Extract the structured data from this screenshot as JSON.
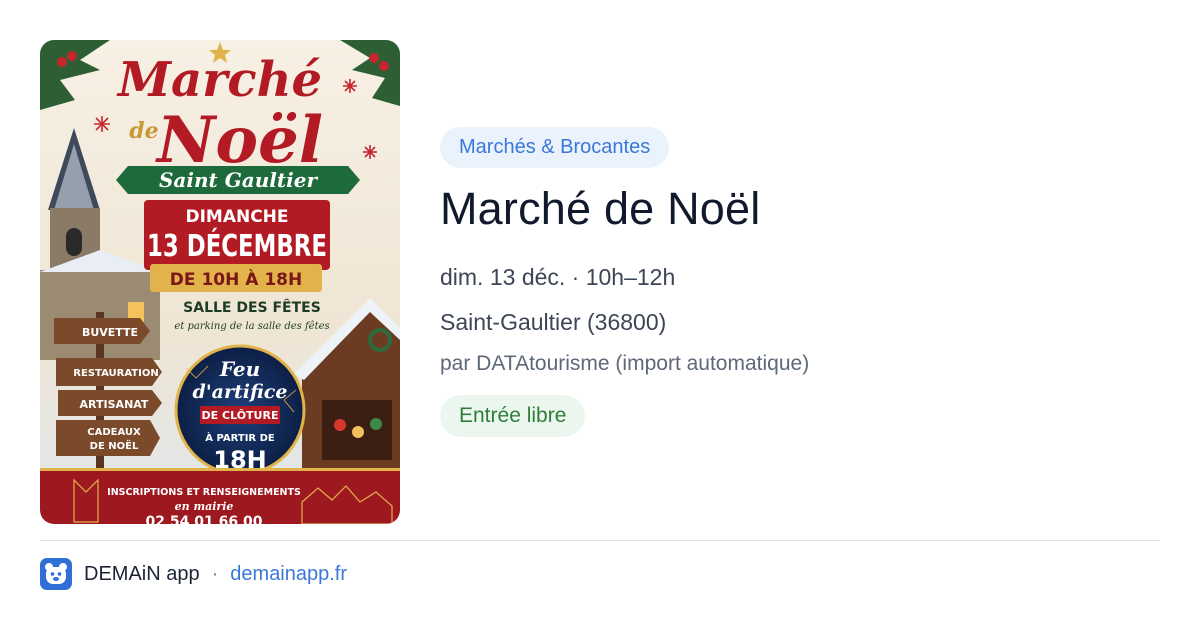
{
  "card": {
    "category": "Marchés & Brocantes",
    "title": "Marché de Noël",
    "date_time": "dim. 13 déc. · 10h–12h",
    "location": "Saint-Gaultier (36800)",
    "source": "par DATAtourisme (import automatique)",
    "price_badge": "Entrée libre"
  },
  "poster": {
    "title_line1": "Marché",
    "title_de": "de",
    "title_line2": "Noël",
    "town": "Saint Gaultier",
    "day": "DIMANCHE",
    "date": "13 DÉCEMBRE",
    "hours": "DE 10H À 18H",
    "venue": "SALLE DES FÊTES",
    "parking": "et parking de la salle des fêtes",
    "signs": [
      "BUVETTE",
      "RESTAURATION",
      "ARTISANAT",
      "CADEAUX",
      "DE NOËL"
    ],
    "fireworks_1": "Feu",
    "fireworks_2": "d'artifice",
    "fireworks_3": "DE CLÔTURE",
    "fireworks_4": "À PARTIR DE",
    "fireworks_time": "18H",
    "info_1": "INSCRIPTIONS ET RENSEIGNEMENTS",
    "info_2": "en mairie",
    "phone": "02 54 01 66 00"
  },
  "footer": {
    "app_name": "DEMAiN app",
    "separator": "·",
    "site": "demainapp.fr"
  },
  "colors": {
    "accent_blue": "#3b78d8",
    "category_bg": "#eaf2fc",
    "free_green": "#2f7d3a",
    "free_bg": "#ebf7ee",
    "poster_red": "#b31b24",
    "poster_green": "#1d6b3a",
    "poster_gold": "#e2b24b"
  },
  "icons": {
    "app_icon": "bear-face-icon"
  }
}
